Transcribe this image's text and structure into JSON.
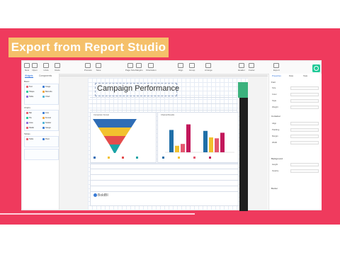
{
  "badge": {
    "text": "Export from Report Studio"
  },
  "app": {
    "toolbar": [
      {
        "label": "New"
      },
      {
        "label": "Open"
      },
      {
        "label": "Undo"
      },
      {
        "label": "Redo"
      },
      {
        "label": "Preview"
      },
      {
        "label": "Save"
      },
      {
        "label": "Page Size"
      },
      {
        "label": "Margins"
      },
      {
        "label": "Orientation"
      },
      {
        "label": "Align"
      },
      {
        "label": "Group"
      },
      {
        "label": "Arrange"
      },
      {
        "label": "Header"
      },
      {
        "label": "Footer"
      },
      {
        "label": "Export"
      }
    ],
    "sidebar": {
      "tabs": [
        "Widgets",
        "Components"
      ],
      "sections": [
        "Basic",
        "Charts",
        "Tables"
      ],
      "items_basic": [
        "Text",
        "Image",
        "Shape",
        "Barcode",
        "Table",
        "Chart"
      ],
      "items_charts": [
        "Bar",
        "Line",
        "Pie",
        "Funnel",
        "Area",
        "Scatter",
        "Radar",
        "Gauge"
      ],
      "items_tables": [
        "Table",
        "Pivot"
      ]
    },
    "report": {
      "title": "Campaign Performance",
      "funnel_panel_title": "Conversion Funnel",
      "bar_panel_title": "Channel Results",
      "logo_text": "BoldBI"
    },
    "right_panel": {
      "tabs": [
        "Properties",
        "Data",
        "Style"
      ],
      "sections": [
        "Font",
        "Container",
        "Background",
        "Border"
      ],
      "labels": [
        "Size",
        "Color",
        "Style",
        "Weight",
        "Align",
        "Padding",
        "Margin",
        "Width",
        "Height",
        "Opacity"
      ]
    }
  },
  "chart_data": [
    {
      "type": "funnel",
      "title": "",
      "stages": [
        {
          "value": 100,
          "color": "#2f6db5"
        },
        {
          "value": 72,
          "color": "#f2c12e"
        },
        {
          "value": 45,
          "color": "#e44c4c"
        },
        {
          "value": 22,
          "color": "#1aa3a6"
        }
      ]
    },
    {
      "type": "bar",
      "title": "",
      "categories": [
        "A",
        "B"
      ],
      "series": [
        {
          "values": [
            48,
            46
          ],
          "color": "#1f6fa8"
        },
        {
          "values": [
            14,
            32
          ],
          "color": "#f2c12e"
        },
        {
          "values": [
            18,
            30
          ],
          "color": "#e4576f"
        },
        {
          "values": [
            60,
            42
          ],
          "color": "#c2185b"
        }
      ],
      "ylim": [
        0,
        70
      ]
    }
  ]
}
